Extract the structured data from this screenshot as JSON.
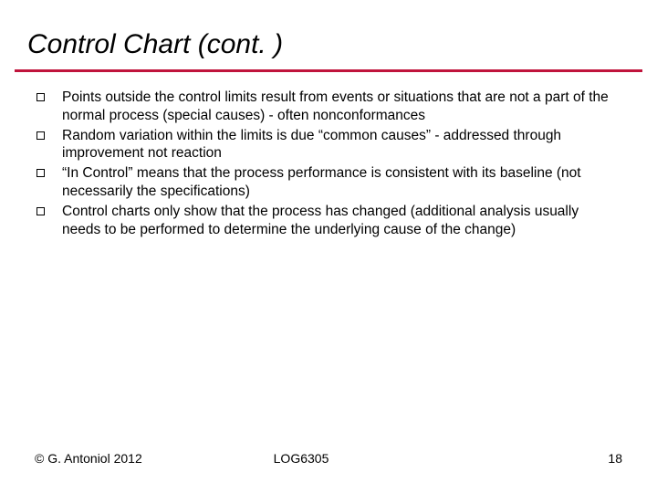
{
  "title": "Control Chart (cont. )",
  "bullets": [
    "Points outside the control limits result from events or situations that are not a part of the normal process (special causes) - often nonconformances",
    "Random variation within the limits is due “common causes” - addressed through improvement not reaction",
    "“In Control” means that the process performance is consistent with its baseline (not necessarily the specifications)",
    "Control charts only show that the process has changed (additional analysis usually needs to be performed to determine the underlying cause of the change)"
  ],
  "footer": {
    "copyright": "© G. Antoniol 2012",
    "course": "LOG6305",
    "page": "18"
  }
}
